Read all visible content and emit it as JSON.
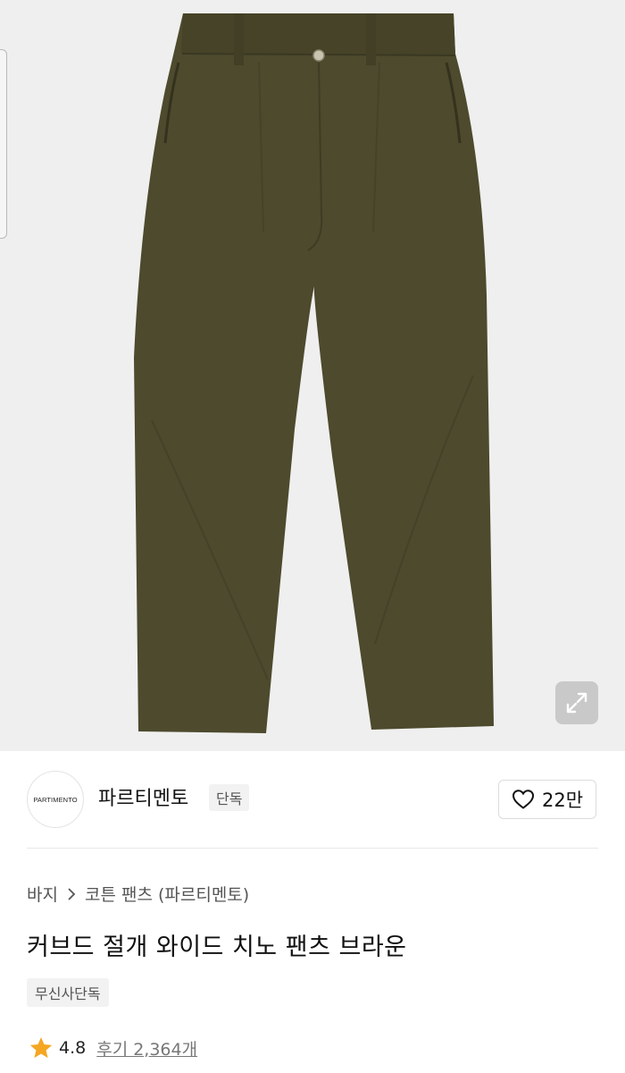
{
  "product_image": {
    "alt": "product-photo-pants",
    "pants_color": "#4d4a2d",
    "background": "#efefef"
  },
  "brand": {
    "logo_text": "PARTIMENTO",
    "name": "파르티멘토",
    "badge": "단독"
  },
  "like": {
    "icon": "heart-outline-icon",
    "count": "22만"
  },
  "breadcrumb": {
    "category": "바지",
    "separator_icon": "chevron-right-icon",
    "subcategory": "코튼 팬츠 (파르티멘토)"
  },
  "product": {
    "title": "커브드 절개 와이드 치노 팬츠 브라운",
    "tag": "무신사단독"
  },
  "rating": {
    "icon": "star-icon",
    "star_color": "#f5a623",
    "score": "4.8",
    "reviews_label": "후기 2,364개"
  }
}
